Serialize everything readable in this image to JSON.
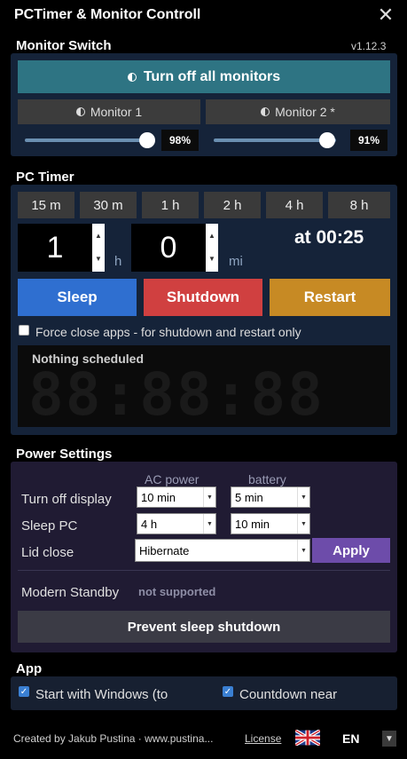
{
  "window": {
    "title": "PCTimer & Monitor Controll",
    "close_glyph": "✕"
  },
  "monitor_switch": {
    "heading": "Monitor Switch",
    "version": "v1.12.3",
    "all_off_label": "Turn off all monitors",
    "monitors": [
      {
        "label": "Monitor 1",
        "brightness_label": "98%",
        "brightness": 0.98
      },
      {
        "label": "Monitor 2 *",
        "brightness_label": "91%",
        "brightness": 0.91
      }
    ]
  },
  "pc_timer": {
    "heading": "PC Timer",
    "presets": [
      "15 m",
      "30 m",
      "1 h",
      "2 h",
      "4 h",
      "8 h"
    ],
    "hours_value": "1",
    "hours_unit": "h",
    "minutes_value": "0",
    "minutes_unit": "mi",
    "at_time": "at 00:25",
    "actions": {
      "sleep": "Sleep",
      "shutdown": "Shutdown",
      "restart": "Restart"
    },
    "force_close_label": "Force close apps - for shutdown and restart only",
    "schedule_status": "Nothing scheduled",
    "countdown_display": "88:88:88"
  },
  "power_settings": {
    "heading": "Power Settings",
    "col_ac": "AC power",
    "col_battery": "battery",
    "rows": {
      "display": {
        "label": "Turn off display",
        "ac": "10 min",
        "battery": "5 min"
      },
      "sleep": {
        "label": "Sleep PC",
        "ac": "4 h",
        "battery": "10 min"
      },
      "lid": {
        "label": "Lid close",
        "value": "Hibernate"
      }
    },
    "apply_label": "Apply",
    "modern_standby_label": "Modern Standby",
    "modern_standby_value": "not supported",
    "prevent_label": "Prevent sleep  shutdown"
  },
  "app": {
    "heading": "App",
    "start_with_windows": "Start with Windows (to",
    "countdown_near": "Countdown near"
  },
  "footer": {
    "credit": "Created by Jakub Pustina  ·  www.pustina...",
    "license": "License",
    "language": "EN"
  },
  "colors": {
    "monitor_panel": "#152339",
    "all_off_button": "#2e7483",
    "sleep": "#2f6fd0",
    "shutdown": "#d04040",
    "restart": "#c78a24",
    "power_panel": "#201b33",
    "apply": "#6d4caa"
  }
}
